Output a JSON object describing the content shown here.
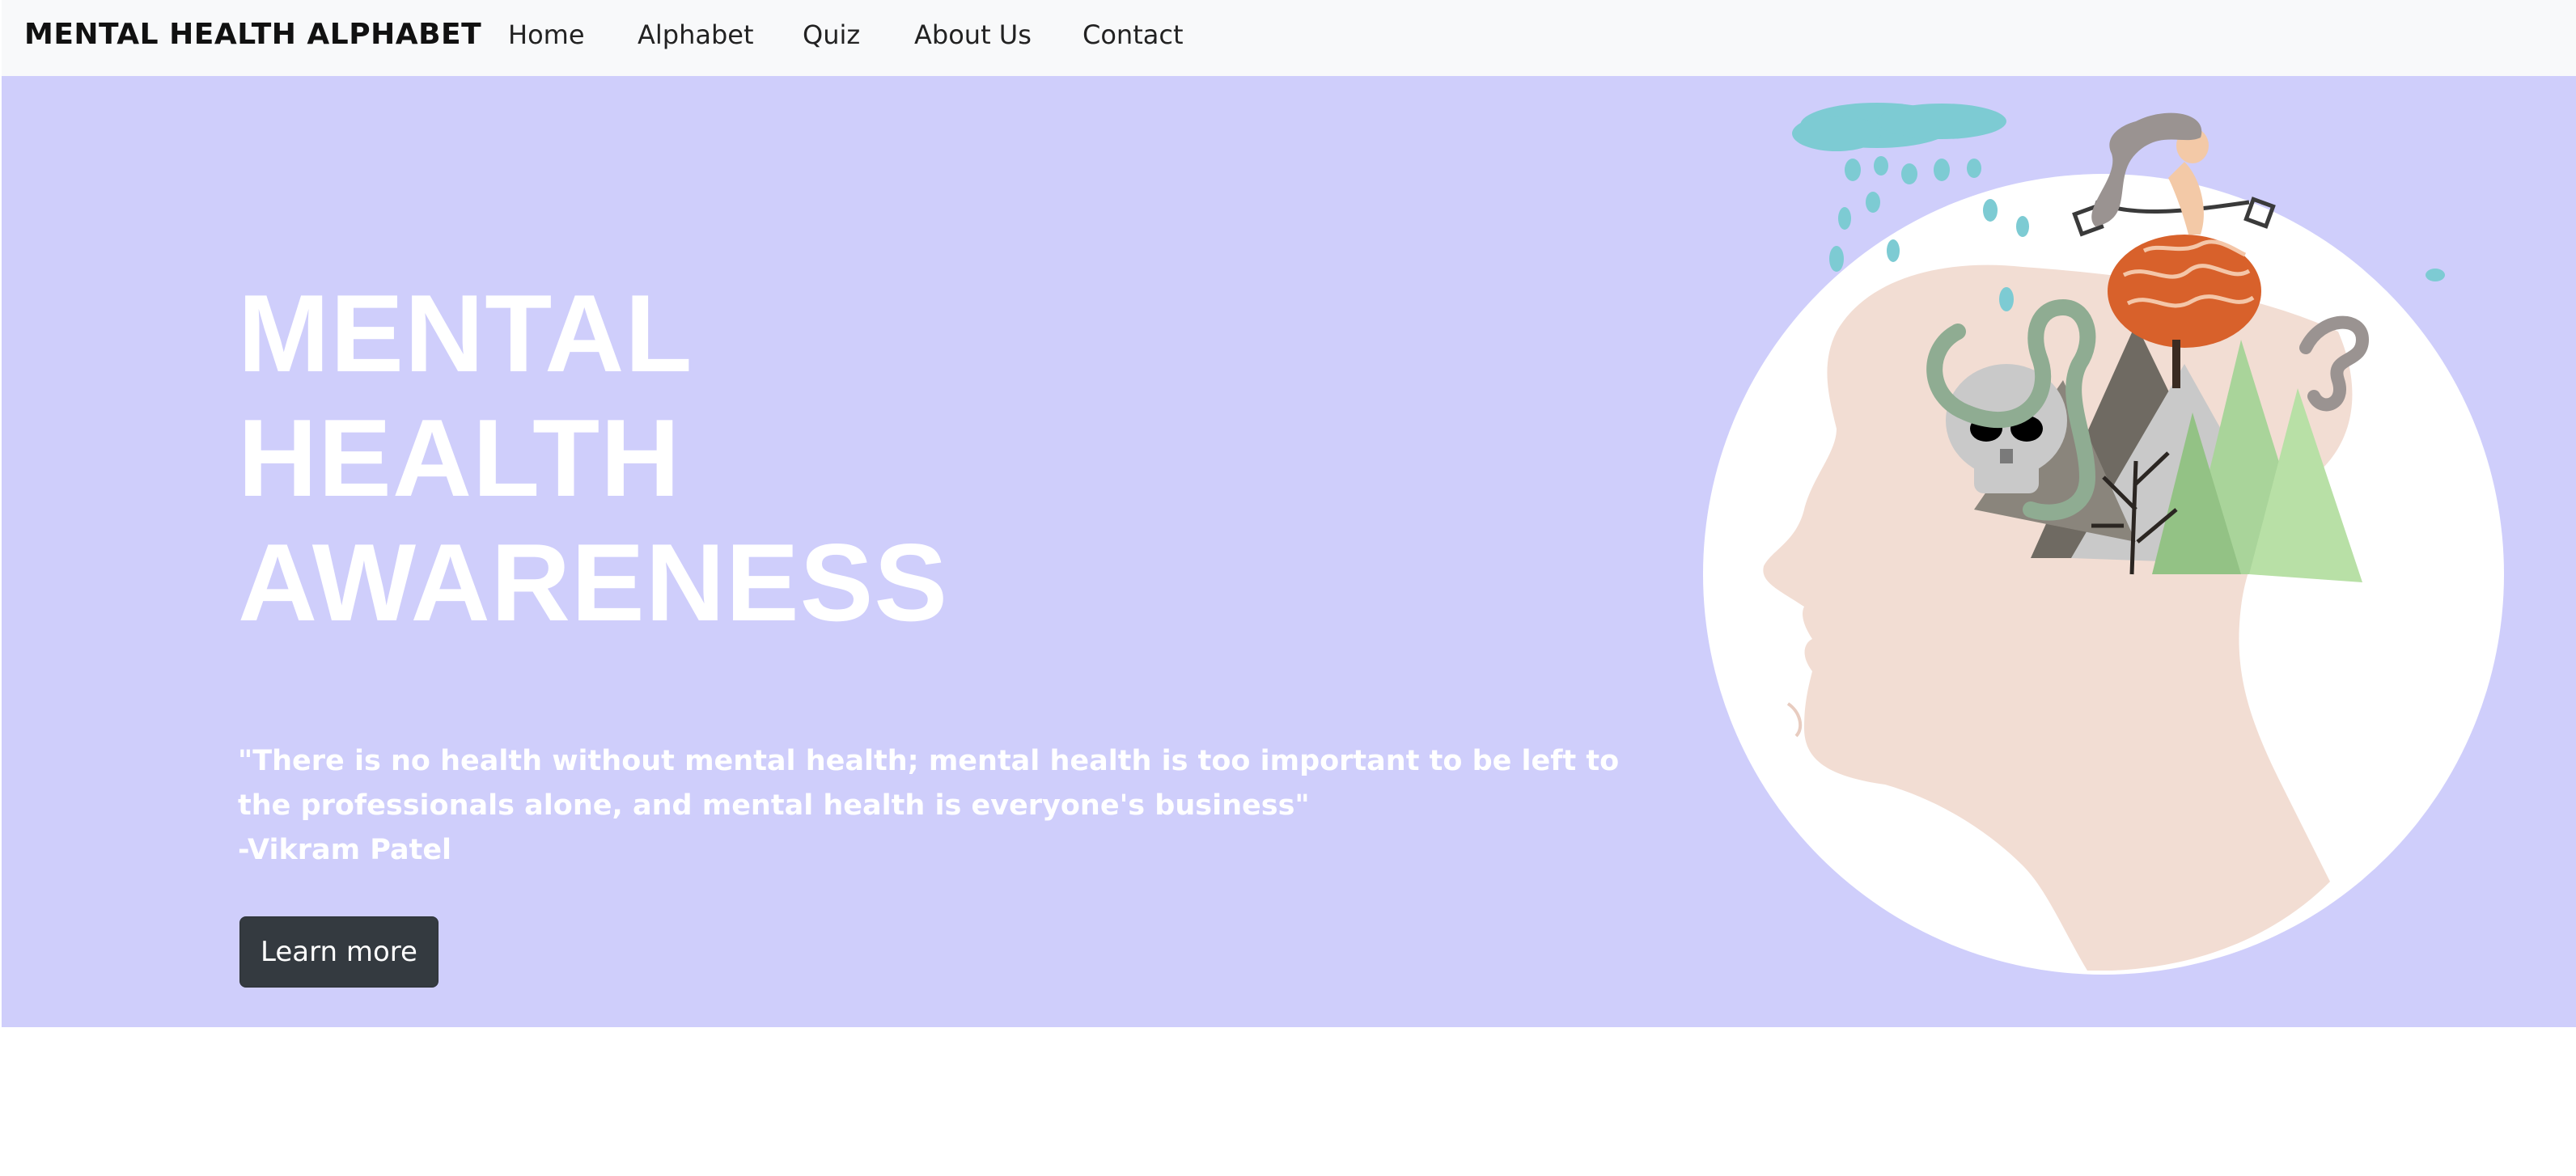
{
  "navbar": {
    "brand": "MENTAL HEALTH ALPHABET",
    "links": [
      "Home",
      "Alphabet",
      "Quiz",
      "About Us",
      "Contact"
    ]
  },
  "hero": {
    "title_lines": [
      "MENTAL",
      "HEALTH",
      "AWARENESS"
    ],
    "quote_lines": [
      "\"There is no health without mental health; mental health is too important to be left to",
      "the professionals alone, and mental health is everyone's business\"",
      "-Vikram Patel"
    ],
    "button_label": "Learn more",
    "illustration": "head-with-mind-contents-illustration"
  },
  "colors": {
    "hero_background": "#cfcefb",
    "navbar_background": "#f8f9fa",
    "button_background": "#343a40",
    "text_white": "#ffffff"
  }
}
